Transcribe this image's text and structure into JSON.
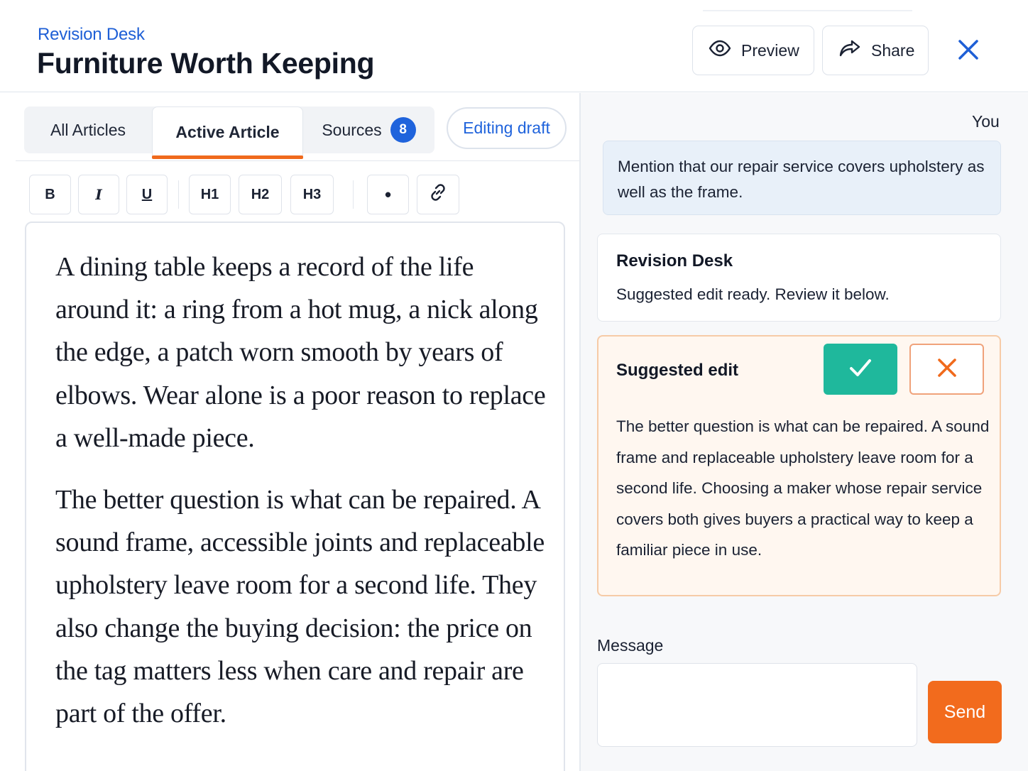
{
  "header": {
    "app_name": "Revision Desk",
    "doc_title": "Furniture Worth Keeping",
    "preview_label": "Preview",
    "share_label": "Share",
    "preview_icon": "eye-icon",
    "share_icon": "share-arrow-icon",
    "close_icon": "close-icon"
  },
  "tabs": {
    "all_articles": "All Articles",
    "active_article": "Active Article",
    "sources": "Sources",
    "sources_count": "8",
    "editing_status": "Editing draft"
  },
  "toolbar": {
    "bold": "B",
    "italic": "I",
    "underline": "U",
    "h1": "H1",
    "h2": "H2",
    "h3": "H3",
    "bullet": "•",
    "link_icon": "link-icon"
  },
  "editor": {
    "paragraphs": [
      "A dining table keeps a record of the life around it: a ring from a hot mug, a nick along the edge, a patch worn smooth by years of elbows. Wear alone is a poor reason to replace a well-made piece.",
      "The better question is what can be repaired. A sound frame, accessible joints and replaceable upholstery leave room for a second life. They also change the buying decision: the price on the tag matters less when care and repair are part of the offer."
    ]
  },
  "chat": {
    "user_label": "You",
    "user_message": "Mention that our repair service covers upholstery as well as the frame.",
    "assistant_name": "Revision Desk",
    "assistant_message": "Suggested edit ready. Review it below.",
    "suggestion_title": "Suggested edit",
    "suggestion_text": "The better question is what can be repaired. A sound frame and replaceable upholstery leave room for a second life. Choosing a maker whose repair service covers both gives buyers a practical way to keep a familiar piece in use.",
    "accept_icon": "check-icon",
    "reject_icon": "x-icon"
  },
  "composer": {
    "label": "Message",
    "value": "",
    "send_label": "Send"
  },
  "colors": {
    "accent_blue": "#1f63dc",
    "accent_orange": "#f26b1d",
    "accept_green": "#1fb89c"
  }
}
